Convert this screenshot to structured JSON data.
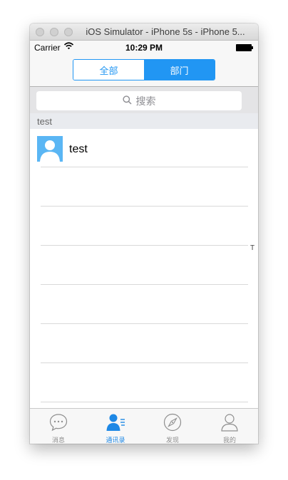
{
  "window": {
    "title": "iOS Simulator - iPhone 5s - iPhone 5..."
  },
  "statusbar": {
    "carrier": "Carrier",
    "time": "10:29 PM"
  },
  "segmented": {
    "all_label": "全部",
    "dept_label": "部门",
    "selected": "部门"
  },
  "search": {
    "placeholder": "搜索"
  },
  "section": {
    "title": "test"
  },
  "contacts": [
    {
      "name": "test"
    }
  ],
  "index_letter": "T",
  "tabbar": {
    "items": [
      {
        "label": "消息",
        "icon": "chat-bubble-icon",
        "active": false
      },
      {
        "label": "通讯录",
        "icon": "contacts-icon",
        "active": true
      },
      {
        "label": "发现",
        "icon": "compass-icon",
        "active": false
      },
      {
        "label": "我的",
        "icon": "profile-icon",
        "active": false
      }
    ]
  },
  "colors": {
    "accent": "#2196f3",
    "avatar_bg": "#5ab6f4"
  }
}
